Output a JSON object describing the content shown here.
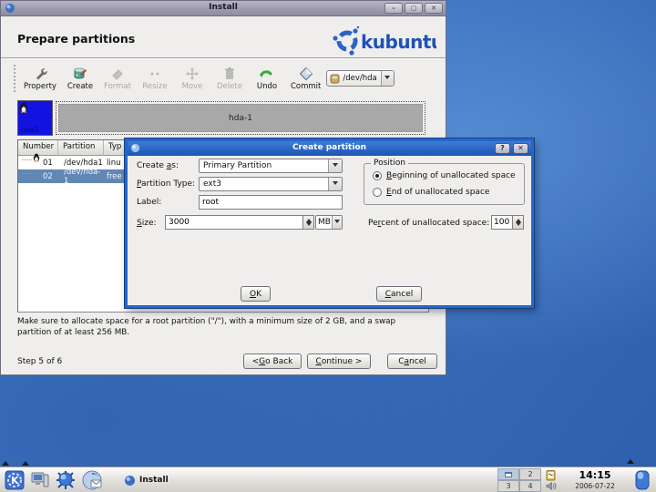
{
  "window": {
    "title": "Install",
    "heading": "Prepare partitions",
    "brand": "kubuntu",
    "controls": {
      "minimize": "–",
      "maximize": "▢",
      "close": "✕"
    },
    "toolbar": {
      "items": [
        {
          "label": "Property",
          "enabled": true
        },
        {
          "label": "Create",
          "enabled": true
        },
        {
          "label": "Format",
          "enabled": false
        },
        {
          "label": "Resize",
          "enabled": false
        },
        {
          "label": "Move",
          "enabled": false
        },
        {
          "label": "Delete",
          "enabled": false
        },
        {
          "label": "Undo",
          "enabled": true
        },
        {
          "label": "Commit",
          "enabled": true
        }
      ],
      "device": "/dev/hda"
    },
    "diskmap": {
      "square_label": "hda1",
      "bar_label": "hda-1"
    },
    "table": {
      "columns": [
        "Number",
        "Partition",
        "Typ"
      ],
      "rows": [
        {
          "number": "01",
          "partition": "/dev/hda1",
          "type": "linu"
        },
        {
          "number": "02",
          "partition": "/dev/hda-1",
          "type": "free"
        }
      ]
    },
    "note": "Make sure to allocate space for a root partition (\"/\"), with a minimum size of 2 GB, and a swap partition of at least 256 MB.",
    "step": "Step 5 of 6",
    "back_button": "< Go Back",
    "continue_button": "Continue >",
    "cancel_button": "Cancel"
  },
  "dialog": {
    "title": "Create partition",
    "help_button": "?",
    "close_button": "✕",
    "create_as_label": "Create as:",
    "create_as_value": "Primary Partition",
    "type_label": "Partition Type:",
    "type_value": "ext3",
    "label_label": "Label:",
    "label_value": "root",
    "size_label": "Size:",
    "size_value": "3000",
    "unit_value": "MB",
    "position_legend": "Position",
    "radio_beginning": "Beginning of unallocated space",
    "radio_end": "End of unallocated space",
    "percent_label": "Percent of unallocated space:",
    "percent_value": "100",
    "ok_button": "OK",
    "cancel_button": "Cancel"
  },
  "taskbar": {
    "task": "Install",
    "pager": {
      "d2": "2",
      "d3": "3",
      "d4": "4"
    },
    "time": "14:15",
    "date": "2006-07-22"
  },
  "colors": {
    "dialog_accent": "#2565cd",
    "selection": "#6187b5",
    "brand_blue": "#1d51b8",
    "partition_blue": "#1213e0",
    "free_space_gray": "#a8a8a8"
  }
}
